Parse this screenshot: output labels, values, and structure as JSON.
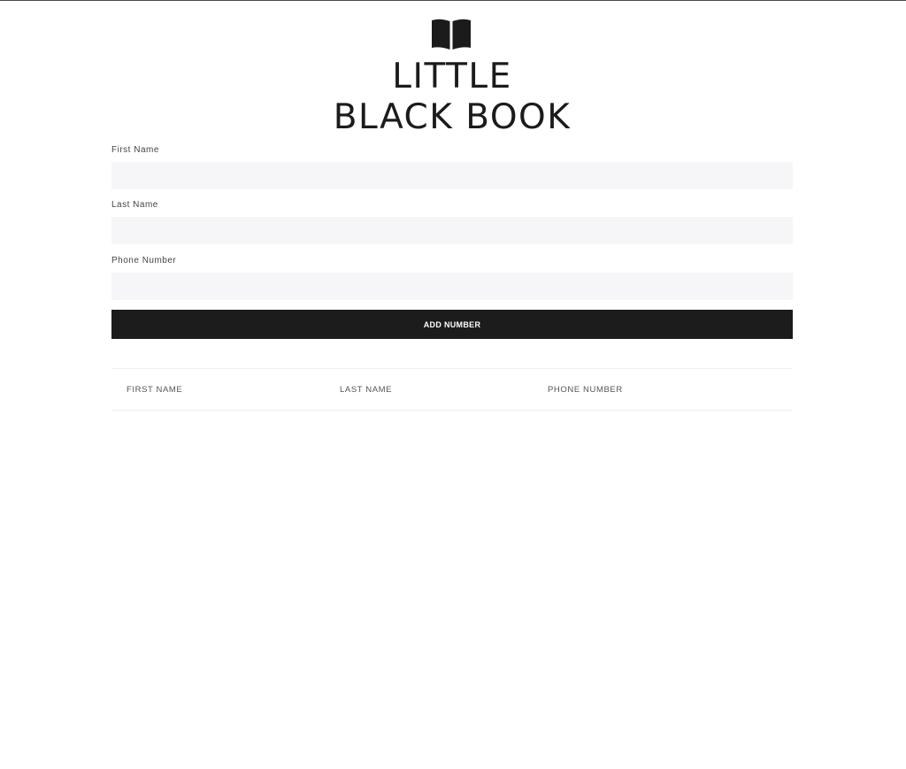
{
  "header": {
    "title_line1": "LITTLE",
    "title_line2": "BLACK BOOK",
    "icon": "open-book-icon"
  },
  "form": {
    "first_name_label": "First Name",
    "first_name_value": "",
    "last_name_label": "Last Name",
    "last_name_value": "",
    "phone_label": "Phone Number",
    "phone_value": "",
    "submit_label": "ADD NUMBER"
  },
  "table": {
    "columns": [
      "FIRST NAME",
      "LAST NAME",
      "PHONE NUMBER"
    ],
    "rows": []
  },
  "colors": {
    "primary": "#1c1c1c",
    "input_bg": "#f6f6f8",
    "background": "#ffffff"
  }
}
